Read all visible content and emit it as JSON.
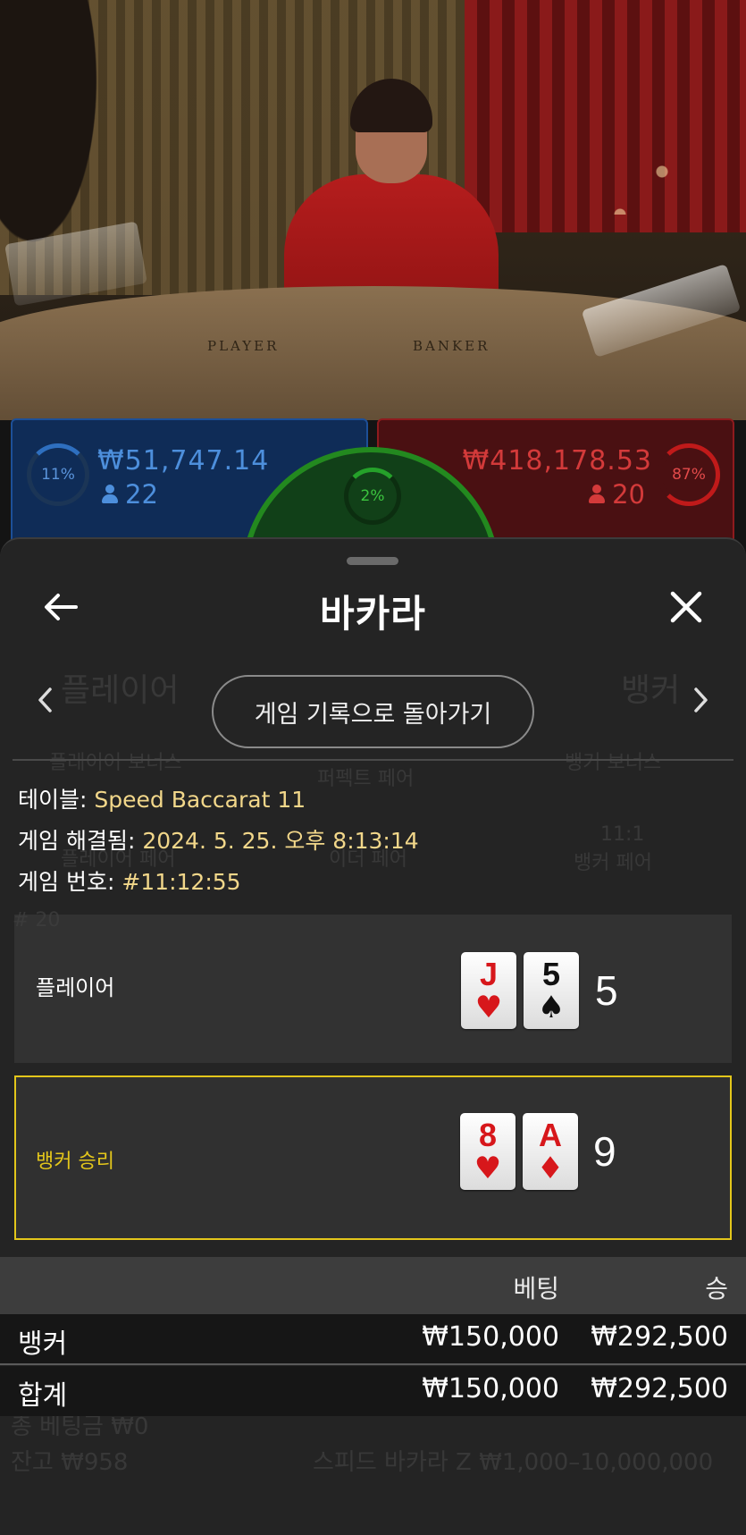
{
  "video": {
    "table_player_word": "PLAYER",
    "table_banker_word": "BANKER"
  },
  "bet_stats": {
    "player": {
      "percent": "11%",
      "amount": "₩51,747.14",
      "count": "22",
      "color": "#4d8fdc"
    },
    "tie": {
      "percent": "2%",
      "color": "#3cc43f"
    },
    "banker": {
      "percent": "87%",
      "amount": "₩418,178.53",
      "count": "20",
      "color": "#d33a3a"
    }
  },
  "sheet": {
    "title": "바카라",
    "back_icon": "arrow-left-icon",
    "close_icon": "close-icon",
    "back_to_history_label": "게임 기록으로 돌아가기",
    "prev_icon": "chevron-left-icon",
    "next_icon": "chevron-right-icon",
    "info": {
      "table_label": "테이블:",
      "table_value": "Speed Baccarat 11",
      "resolved_label": "게임 해결됨:",
      "resolved_value": "2024. 5. 25. 오후 8:13:14",
      "game_no_label": "게임 번호:",
      "game_no_value": "#11:12:55"
    },
    "hands": {
      "player": {
        "label": "플레이어",
        "cards": [
          {
            "rank": "J",
            "suit": "♥",
            "color": "red"
          },
          {
            "rank": "5",
            "suit": "♠",
            "color": "black"
          }
        ],
        "total": "5"
      },
      "banker": {
        "label": "뱅커 승리",
        "cards": [
          {
            "rank": "8",
            "suit": "♥",
            "color": "red"
          },
          {
            "rank": "A",
            "suit": "♦",
            "color": "red"
          }
        ],
        "total": "9",
        "accent": "#e3c61b"
      }
    },
    "bets": {
      "headers": {
        "bet": "베팅",
        "win": "승"
      },
      "rows": [
        {
          "name": "뱅커",
          "bet": "₩150,000",
          "win": "₩292,500"
        }
      ],
      "total": {
        "name": "합계",
        "bet": "₩150,000",
        "win": "₩292,500"
      }
    }
  },
  "background_ghost": {
    "player": "플레이어",
    "banker": "뱅커",
    "player_bonus": "플레이어 보너스",
    "perfect_pair": "퍼펙트 페어",
    "banker_bonus": "뱅커 보너스",
    "player_pair": "플레이어 페어",
    "either_pair": "이더 페어",
    "banker_pair_ratio": "11:1",
    "banker_pair": "뱅커 페어",
    "round_count": "# 20",
    "total_bet": "총 베팅금 ₩0",
    "balance": "잔고 ₩958",
    "limits": "스피드 바카라 Z ₩1,000–10,000,000"
  }
}
